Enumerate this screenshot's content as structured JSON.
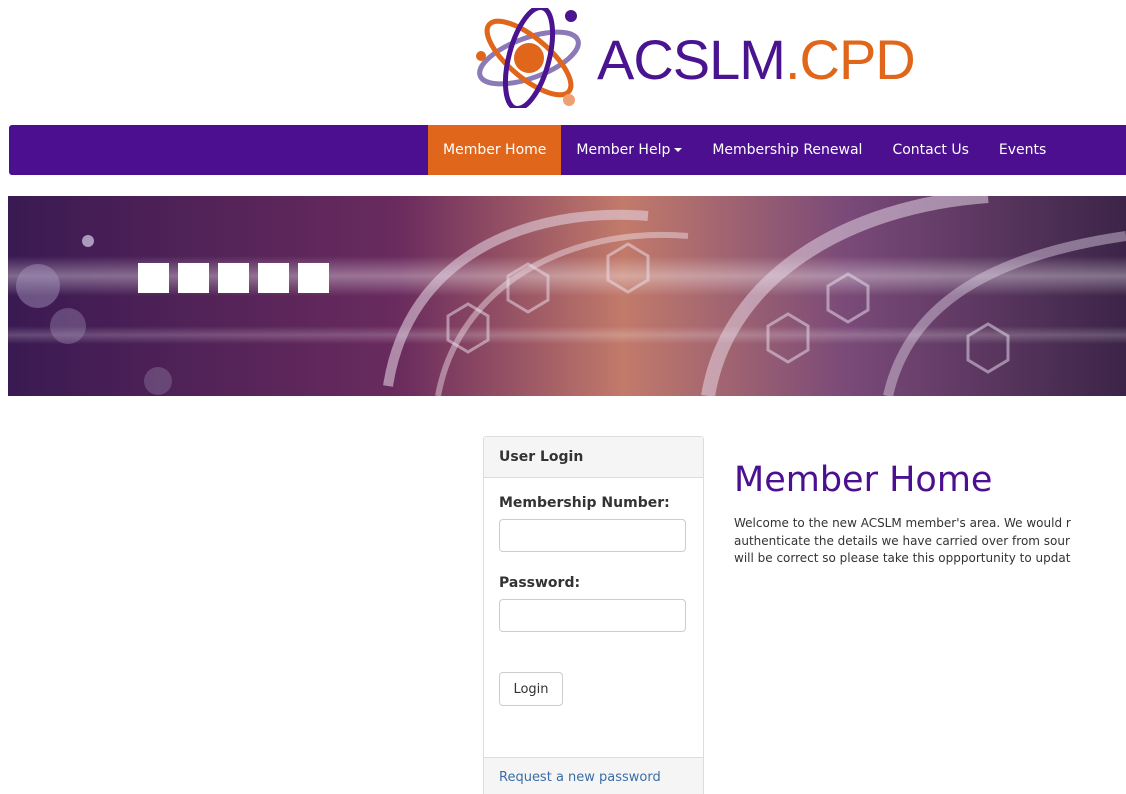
{
  "brand": {
    "name_primary": "ACSLM",
    "name_secondary": ".CPD",
    "color_primary": "#4a1390",
    "color_accent": "#e0661c",
    "icon": "atom-logo-icon"
  },
  "nav": {
    "items": [
      {
        "label": "Member Home",
        "active": true
      },
      {
        "label": "Member Help",
        "dropdown": true
      },
      {
        "label": "Membership Renewal"
      },
      {
        "label": "Contact Us"
      },
      {
        "label": "Events"
      }
    ]
  },
  "login": {
    "heading": "User Login",
    "membership_label": "Membership Number:",
    "membership_value": "",
    "password_label": "Password:",
    "password_value": "",
    "button_label": "Login",
    "request_link": "Request a new password"
  },
  "main": {
    "title": "Member Home",
    "welcome_lines": [
      "Welcome to the new ACSLM member's area. We would r",
      "authenticate the details we have carried over from sour",
      "will be correct so please take this oppportunity to updat"
    ]
  }
}
